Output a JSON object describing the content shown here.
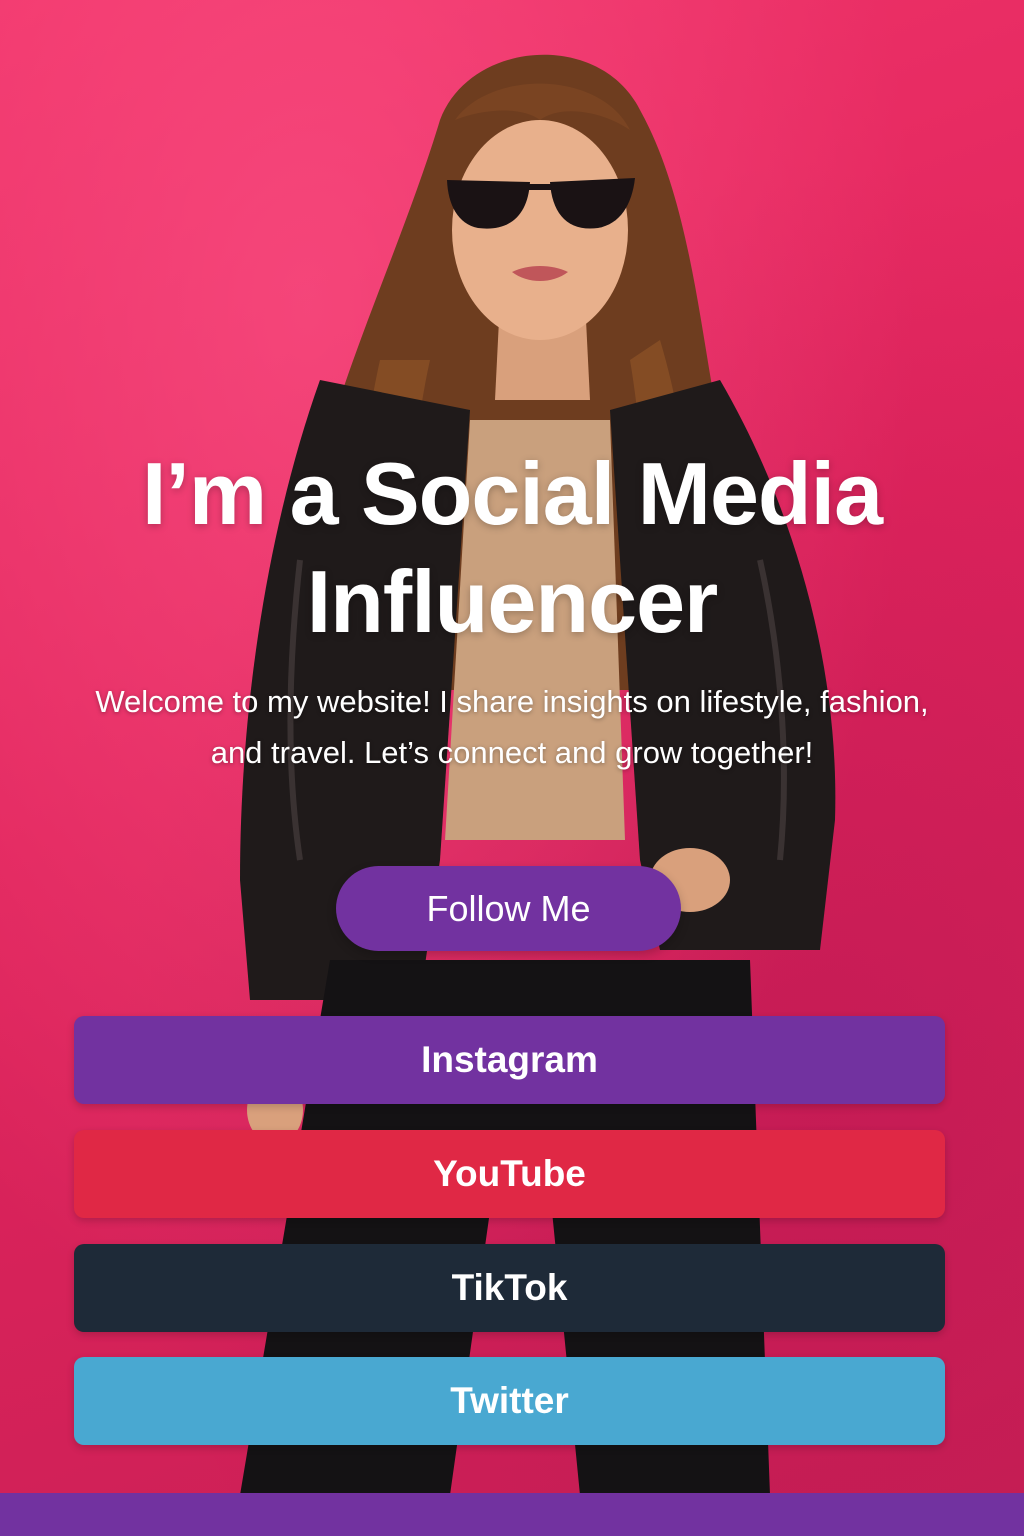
{
  "page": {
    "background_color": "#e8285f"
  },
  "hero": {
    "headline": "I’m a Social Media Influencer",
    "intro": "Welcome to my website! I share insights on lifestyle, fashion, and travel. Let’s connect and grow together!"
  },
  "follow": {
    "label": "Follow Me",
    "color": "#7232a0"
  },
  "links": [
    {
      "label": "Instagram",
      "color": "#7232a0"
    },
    {
      "label": "YouTube",
      "color": "#e02845"
    },
    {
      "label": "TikTok",
      "color": "#1e2a38"
    },
    {
      "label": "Twitter",
      "color": "#49a8d1"
    }
  ],
  "footer": {
    "color": "#7232a0"
  }
}
